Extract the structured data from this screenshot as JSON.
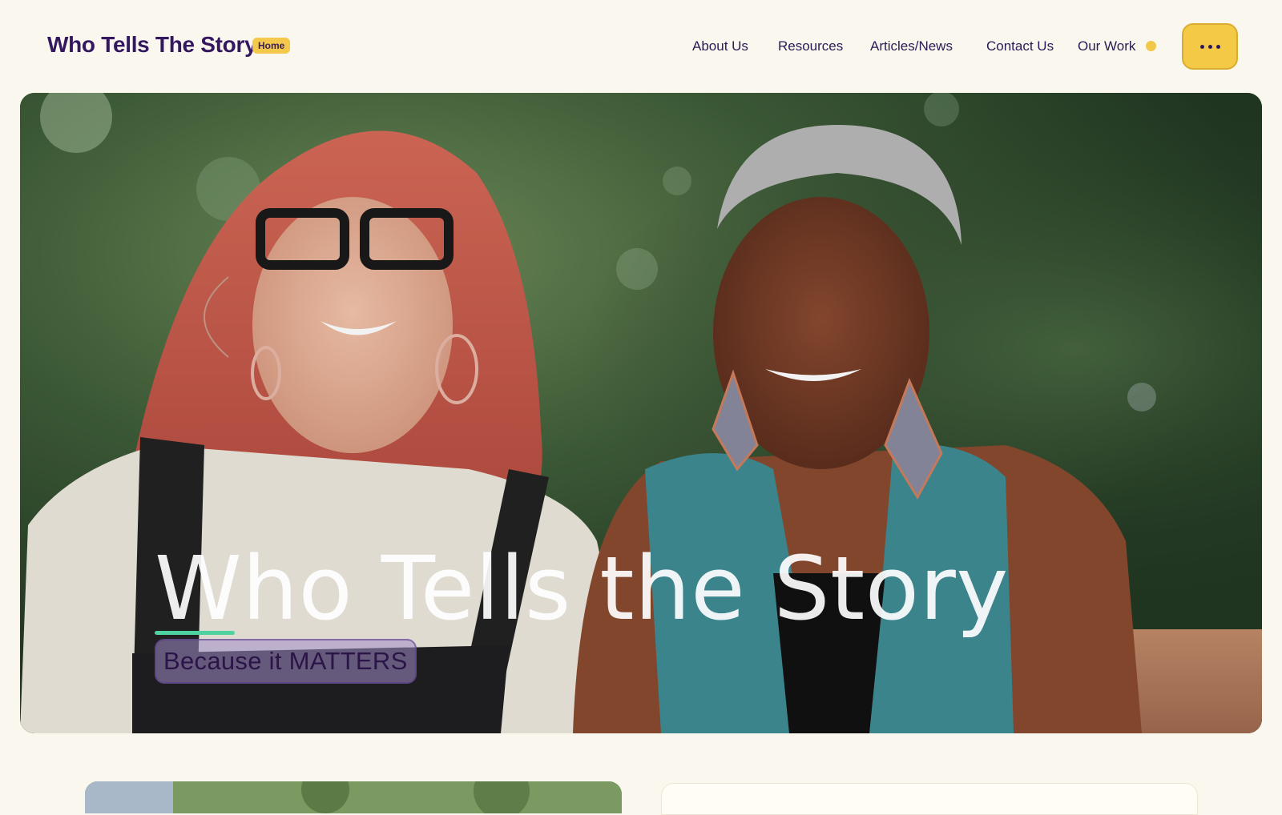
{
  "header": {
    "site_title": "Who Tells The Story",
    "badge": "Home",
    "nav": [
      {
        "label": "About Us"
      },
      {
        "label": "Resources"
      },
      {
        "label": "Articles/News"
      },
      {
        "label": "Contact Us"
      },
      {
        "label": "Our Work"
      }
    ],
    "menu_icon": "ellipsis-icon"
  },
  "hero": {
    "title": "Who Tells the Story",
    "tagline": "Because it MATTERS",
    "image_alt": "Two smiling women seated outdoors in front of greenery"
  },
  "colors": {
    "background": "#faf7ee",
    "primary_text": "#331860",
    "accent_yellow": "#f3c945",
    "accent_green": "#4fd1a0"
  }
}
